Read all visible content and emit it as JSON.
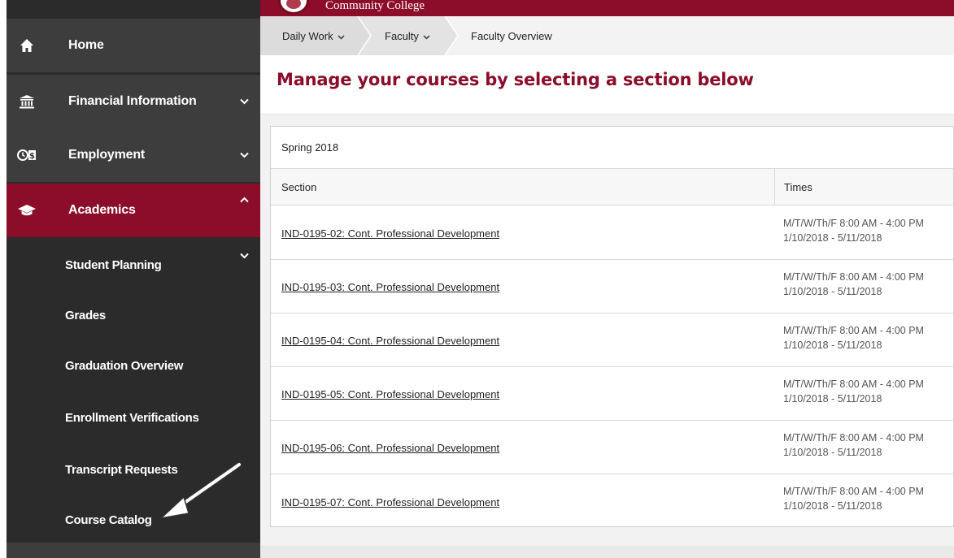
{
  "brand": {
    "name": "Community College"
  },
  "sidebar": {
    "items": [
      {
        "label": "Home",
        "icon": "home-icon"
      },
      {
        "label": "Financial Information",
        "icon": "bank-icon"
      },
      {
        "label": "Employment",
        "icon": "time-pay-icon"
      },
      {
        "label": "Academics",
        "icon": "graduation-cap-icon"
      }
    ],
    "sub_items": [
      {
        "label": "Student Planning"
      },
      {
        "label": "Grades"
      },
      {
        "label": "Graduation Overview"
      },
      {
        "label": "Enrollment Verifications"
      },
      {
        "label": "Transcript Requests"
      },
      {
        "label": "Course Catalog"
      }
    ]
  },
  "breadcrumb": [
    {
      "label": "Daily Work"
    },
    {
      "label": "Faculty"
    },
    {
      "label": "Faculty Overview"
    }
  ],
  "page": {
    "title": "Manage your courses by selecting a section below"
  },
  "table": {
    "term": "Spring 2018",
    "columns": [
      "Section",
      "Times"
    ],
    "rows": [
      {
        "section": "IND-0195-02: Cont. Professional Development",
        "time": "M/T/W/Th/F 8:00 AM - 4:00 PM",
        "dates": "1/10/2018 - 5/11/2018"
      },
      {
        "section": "IND-0195-03: Cont. Professional Development",
        "time": "M/T/W/Th/F 8:00 AM - 4:00 PM",
        "dates": "1/10/2018 - 5/11/2018"
      },
      {
        "section": "IND-0195-04: Cont. Professional Development",
        "time": "M/T/W/Th/F 8:00 AM - 4:00 PM",
        "dates": "1/10/2018 - 5/11/2018"
      },
      {
        "section": "IND-0195-05: Cont. Professional Development",
        "time": "M/T/W/Th/F 8:00 AM - 4:00 PM",
        "dates": "1/10/2018 - 5/11/2018"
      },
      {
        "section": "IND-0195-06: Cont. Professional Development",
        "time": "M/T/W/Th/F 8:00 AM - 4:00 PM",
        "dates": "1/10/2018 - 5/11/2018"
      },
      {
        "section": "IND-0195-07: Cont. Professional Development",
        "time": "M/T/W/Th/F 8:00 AM - 4:00 PM",
        "dates": "1/10/2018 - 5/11/2018"
      }
    ]
  },
  "colors": {
    "brand": "#8b0d2a",
    "sidebar": "#2b2b2b",
    "sidebar_item": "#3d3d3d"
  }
}
